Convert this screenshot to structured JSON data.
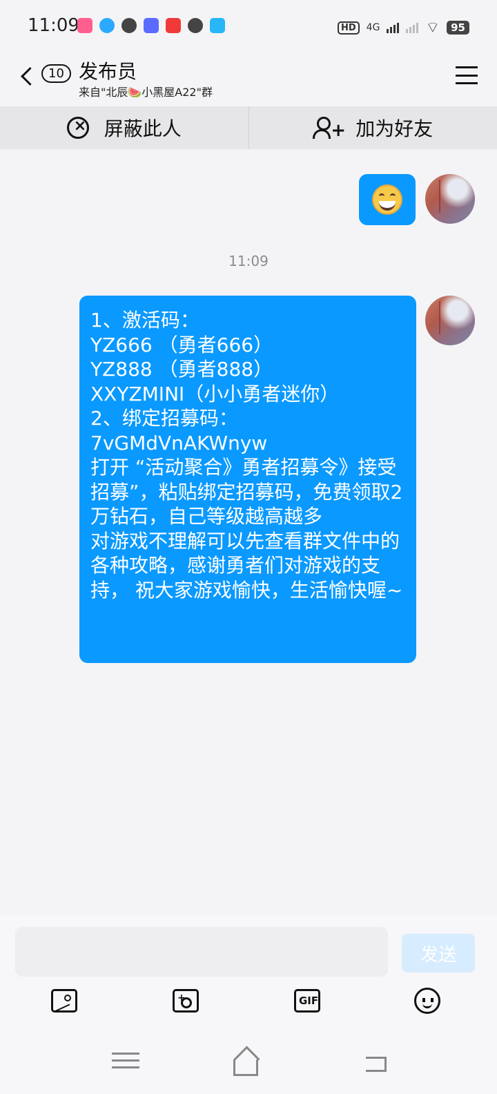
{
  "status_bar": {
    "time": "11:09",
    "hd_label": "HD",
    "network": "4G",
    "battery": "95"
  },
  "header": {
    "unread_count": "10",
    "title": "发布员",
    "subtitle": "来自\"北辰🍉小黑屋A22\"群"
  },
  "actions": {
    "block_label": "屏蔽此人",
    "add_friend_label": "加为好友"
  },
  "chat": {
    "timestamp": "11:09",
    "message_text": "1、激活码：\nYZ666 （勇者666）\nYZ888 （勇者888）\nXXYZMINI（小小勇者迷你）\n2、绑定招募码：\n7vGMdVnAKWnyw\n打开 “活动聚合》勇者招募令》接受招募”，粘贴绑定招募码，免费领取2万钻石，自己等级越高越多\n对游戏不理解可以先查看群文件中的各种攻略，感谢勇者们对游戏的支持， 祝大家游戏愉快，生活愉快喔~"
  },
  "input": {
    "value": "",
    "send_label": "发送"
  },
  "toolbar": {
    "gif_label": "GIF"
  },
  "colors": {
    "bubble_blue": "#0a99ff",
    "send_disabled": "#d7ecff",
    "background": "#f4f4f6"
  }
}
